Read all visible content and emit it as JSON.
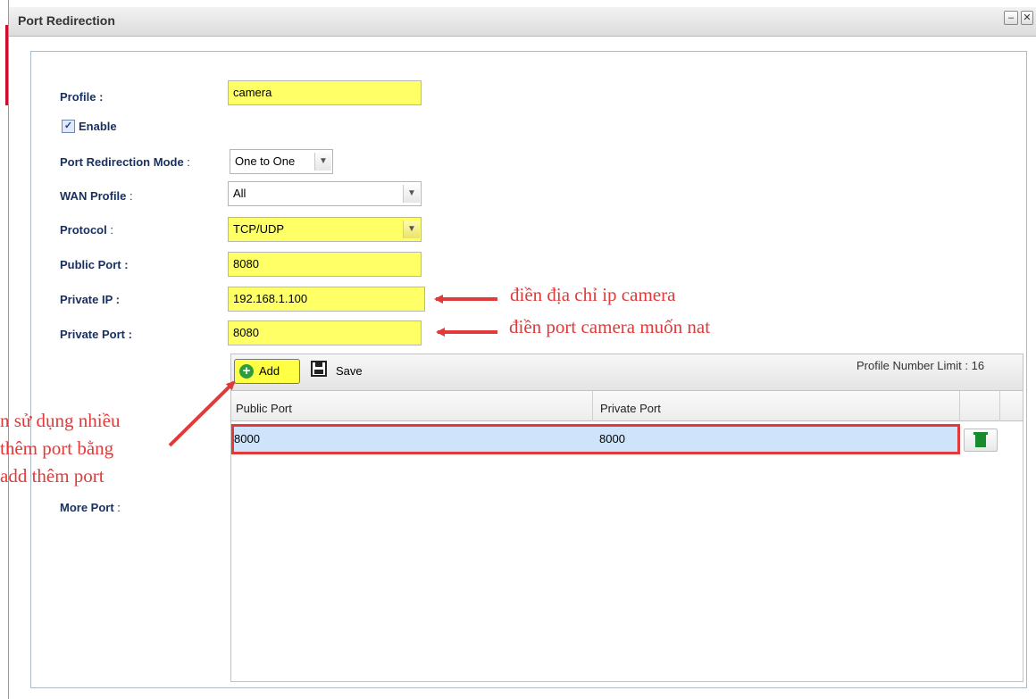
{
  "window": {
    "title": "Port Redirection",
    "min_glyph": "–",
    "close_glyph": "✕"
  },
  "form": {
    "profile_label": "Profile :",
    "profile_value": "camera",
    "enable_label": "Enable",
    "enable_checked": true,
    "mode_label": "Port Redirection Mode",
    "mode_colon": " :",
    "mode_value": "One to One",
    "wan_label": "WAN Profile",
    "wan_colon": " :",
    "wan_value": "All",
    "protocol_label": "Protocol",
    "protocol_colon": " :",
    "protocol_value": "TCP/UDP",
    "public_port_label": "Public Port :",
    "public_port_value": "8080",
    "private_ip_label": "Private IP :",
    "private_ip_value": "192.168.1.100",
    "private_port_label": "Private Port :",
    "private_port_value": "8080",
    "more_port_label": "More Port",
    "more_port_colon": " :"
  },
  "more_port": {
    "add_label": "Add",
    "save_label": "Save",
    "limit_text": "Profile Number Limit :  16",
    "columns": [
      "Public Port",
      "Private Port"
    ],
    "rows": [
      {
        "public_port": "8000",
        "private_port": "8000"
      }
    ]
  },
  "annotations": {
    "ip_note": "điền địa chỉ ip camera",
    "port_note": "điền port camera muốn nat",
    "left_note_lines": [
      "n sử dụng nhiều",
      "thêm port bằng",
      "add thêm port"
    ],
    "color": "#e03a3a"
  },
  "icons": [
    "add-circle-icon",
    "save-disk-icon",
    "trash-icon",
    "chevron-down-icon",
    "checkmark-icon"
  ],
  "colors": {
    "highlight_yellow": "#ffff66",
    "row_selected": "#cfe4fa",
    "label_blue": "#17305e"
  }
}
